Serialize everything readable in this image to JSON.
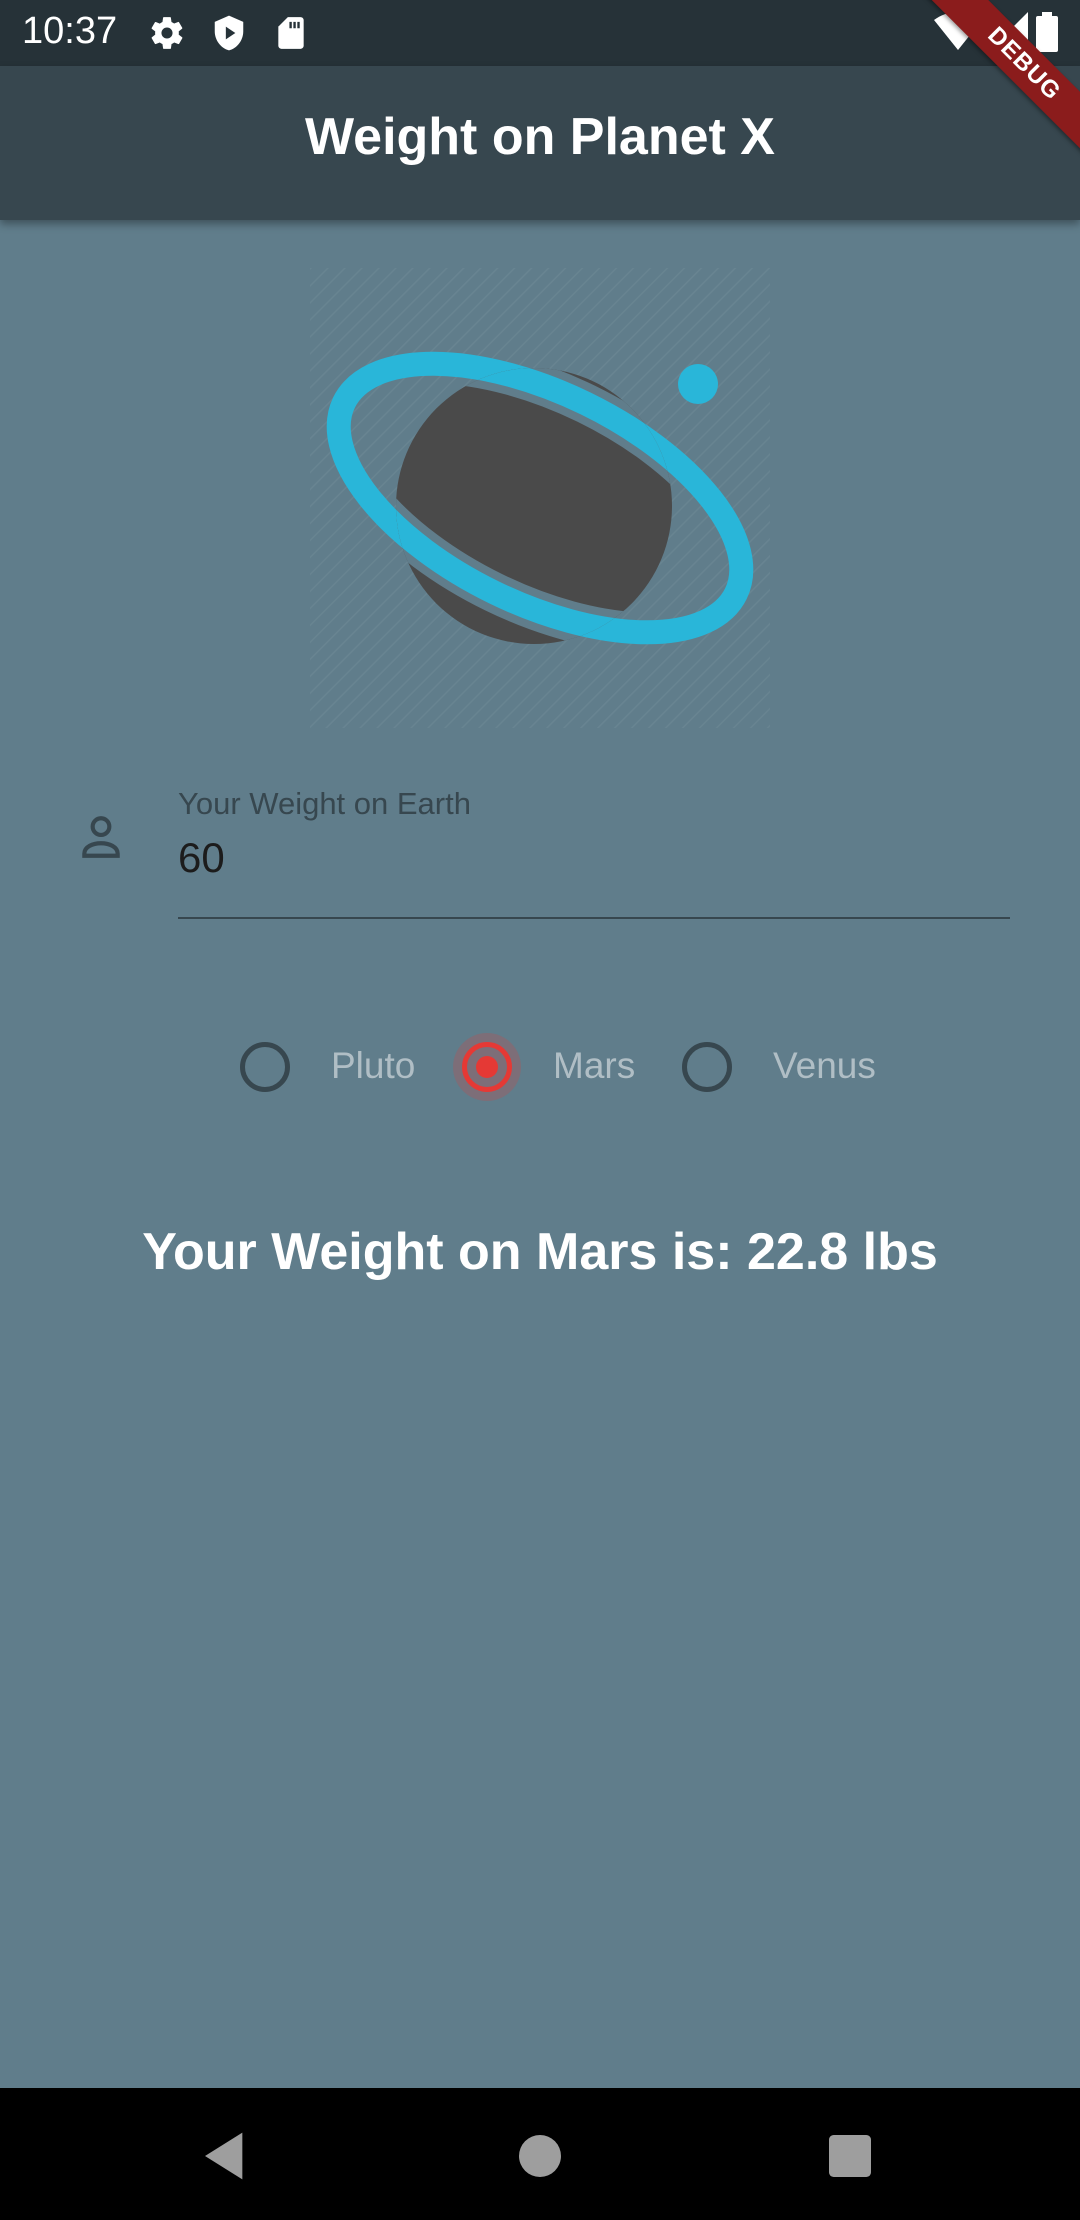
{
  "status_bar": {
    "time": "10:37",
    "left_icons": [
      "gear-icon",
      "shield-icon",
      "sd-card-icon"
    ],
    "right_icons": [
      "wifi-icon",
      "signal-icon",
      "battery-icon"
    ]
  },
  "debug_banner": {
    "label": "DEBUG"
  },
  "app_bar": {
    "title": "Weight on Planet X"
  },
  "planet_image": {
    "icon": "planet-icon",
    "accent": "#29b6d9",
    "body": "#4a4a4a"
  },
  "weight_field": {
    "label": "Your Weight on Earth",
    "value": "60",
    "icon": "person-icon"
  },
  "planets": {
    "options": [
      {
        "label": "Pluto",
        "selected": false
      },
      {
        "label": "Mars",
        "selected": true
      },
      {
        "label": "Venus",
        "selected": false
      }
    ],
    "selected_color": "#e53935"
  },
  "result": {
    "text": "Your Weight on Mars is: 22.8 lbs"
  },
  "nav_bar": {
    "buttons": [
      "back-icon",
      "home-icon",
      "recents-icon"
    ]
  },
  "colors": {
    "background": "#607d8b",
    "app_bar": "#37474f",
    "status_bar": "#263238"
  }
}
